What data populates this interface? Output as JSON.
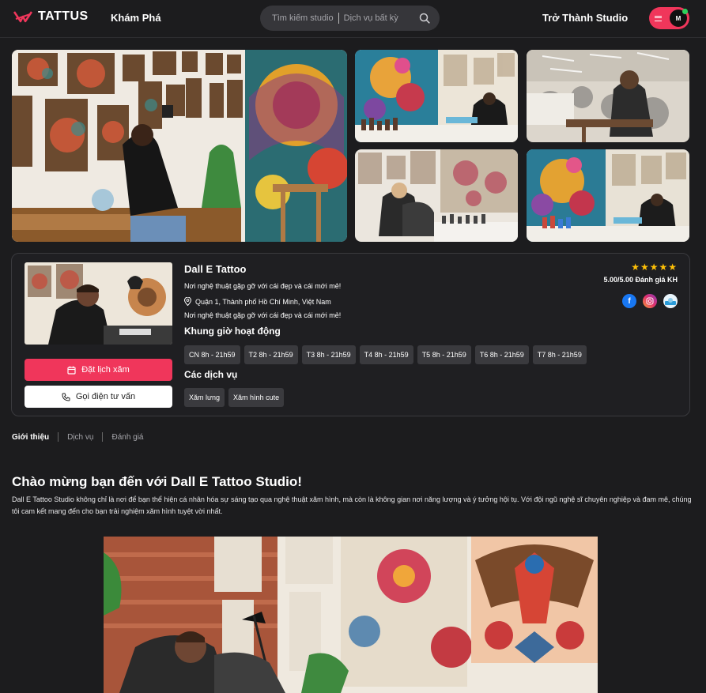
{
  "header": {
    "logo_text": "TATTUS",
    "nav_explore": "Khám Phá",
    "search_studio_placeholder": "Tìm kiếm studio",
    "search_service_placeholder": "Dịch vụ bất kỳ",
    "become_studio": "Trở Thành Studio",
    "avatar_initial": "M"
  },
  "studio": {
    "name": "Dall E Tattoo",
    "tagline": "Nơi nghệ thuật gặp gỡ với cái đẹp và cái mới mẻ!",
    "address": "Quận 1, Thành phố Hồ Chí Minh, Việt Nam",
    "tagline_repeat": "Nơi nghệ thuật gặp gỡ với cái đẹp và cái mới mẻ!",
    "hours_title": "Khung giờ hoạt động",
    "hours": [
      "CN 8h - 21h59",
      "T2 8h - 21h59",
      "T3 8h - 21h59",
      "T4 8h - 21h59",
      "T5 8h - 21h59",
      "T6 8h - 21h59",
      "T7 8h - 21h59"
    ],
    "services_title": "Các dịch vụ",
    "services": [
      "Xăm lưng",
      "Xăm hình cute"
    ],
    "stars": "★★★★★",
    "rating_text": "5.00/5.00 Đánh giá KH",
    "book_label": "Đặt lịch xăm",
    "call_label": "Gọi điện tư vấn"
  },
  "tabs": [
    "Giới thiệu",
    "Dịch vụ",
    "Đánh giá"
  ],
  "intro": {
    "title": "Chào mừng bạn đến với Dall E Tattoo Studio!",
    "body": "Dall E Tattoo Studio không chỉ là nơi để bạn thể hiện cá nhân hóa sự sáng tạo qua nghệ thuật xăm hình, mà còn là không gian nơi năng lượng và ý tưởng hội tụ. Với đội ngũ nghệ sĩ chuyên nghiệp và đam mê, chúng tôi cam kết mang đến cho bạn trải nghiệm xăm hình tuyệt vời nhất."
  },
  "colors": {
    "accent": "#f0365b",
    "background": "#1c1c1e",
    "star": "#ffc107"
  }
}
